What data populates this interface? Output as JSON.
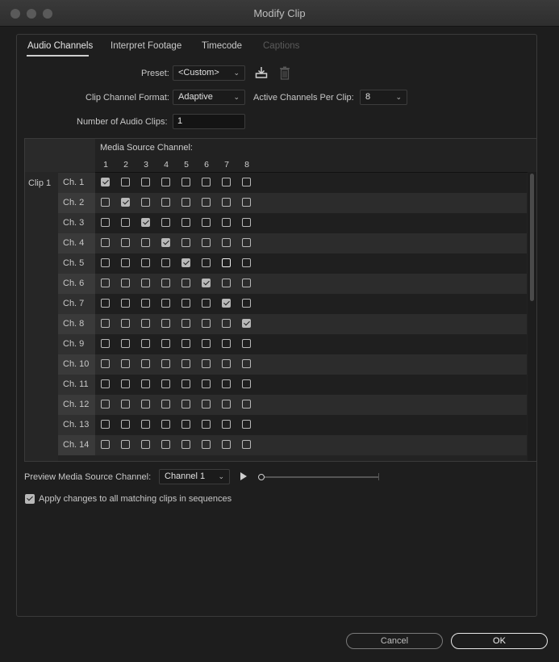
{
  "window": {
    "title": "Modify Clip"
  },
  "tabs": [
    {
      "label": "Audio Channels",
      "active": true
    },
    {
      "label": "Interpret Footage",
      "active": false
    },
    {
      "label": "Timecode",
      "active": false
    },
    {
      "label": "Captions",
      "active": false,
      "disabled": true
    }
  ],
  "preset": {
    "label": "Preset:",
    "value": "<Custom>",
    "save_icon": "save-preset-icon",
    "delete_icon": "trash-icon"
  },
  "clip_channel_format": {
    "label": "Clip Channel Format:",
    "value": "Adaptive"
  },
  "active_channels": {
    "label": "Active Channels Per Clip:",
    "value": "8"
  },
  "num_audio_clips": {
    "label": "Number of Audio Clips:",
    "value": "1"
  },
  "grid": {
    "header": "Media Source Channel:",
    "columns": [
      "1",
      "2",
      "3",
      "4",
      "5",
      "6",
      "7",
      "8"
    ],
    "clip_label": "Clip 1",
    "rows": [
      {
        "label": "Ch. 1",
        "checked": 1
      },
      {
        "label": "Ch. 2",
        "checked": 2
      },
      {
        "label": "Ch. 3",
        "checked": 3
      },
      {
        "label": "Ch. 4",
        "checked": 4
      },
      {
        "label": "Ch. 5",
        "checked": 5
      },
      {
        "label": "Ch. 6",
        "checked": 6
      },
      {
        "label": "Ch. 7",
        "checked": 7
      },
      {
        "label": "Ch. 8",
        "checked": 8
      },
      {
        "label": "Ch. 9",
        "checked": 0
      },
      {
        "label": "Ch. 10",
        "checked": 0
      },
      {
        "label": "Ch. 11",
        "checked": 0
      },
      {
        "label": "Ch. 12",
        "checked": 0
      },
      {
        "label": "Ch. 13",
        "checked": 0
      },
      {
        "label": "Ch. 14",
        "checked": 0
      }
    ]
  },
  "preview": {
    "label": "Preview Media Source Channel:",
    "value": "Channel 1",
    "play_icon": "play-icon",
    "progress": 0
  },
  "apply_all": {
    "label": "Apply changes to all matching clips in sequences",
    "checked": true
  },
  "buttons": {
    "cancel": "Cancel",
    "ok": "OK"
  }
}
